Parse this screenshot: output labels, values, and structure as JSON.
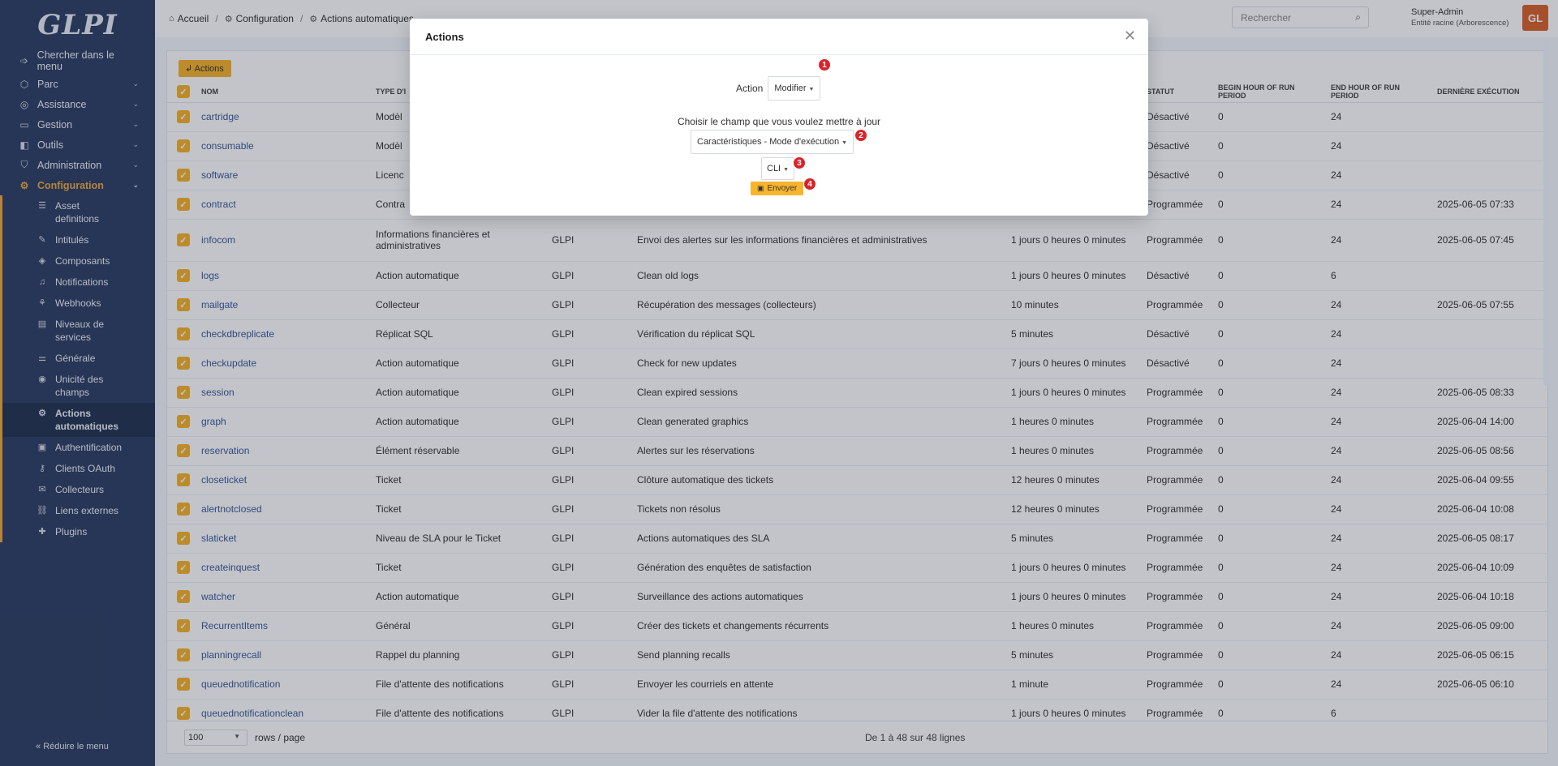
{
  "sidebar": {
    "logo": "GLPI",
    "menu": [
      {
        "label": "Chercher dans le menu",
        "icon": "arrow-right-icon",
        "has_chevron": false
      },
      {
        "label": "Parc",
        "icon": "box-icon",
        "has_chevron": true
      },
      {
        "label": "Assistance",
        "icon": "lifebuoy-icon",
        "has_chevron": true
      },
      {
        "label": "Gestion",
        "icon": "wallet-icon",
        "has_chevron": true
      },
      {
        "label": "Outils",
        "icon": "briefcase-icon",
        "has_chevron": true
      },
      {
        "label": "Administration",
        "icon": "shield-icon",
        "has_chevron": true
      },
      {
        "label": "Configuration",
        "icon": "gear-icon",
        "has_chevron": true
      }
    ],
    "submenu": [
      {
        "label": "Asset definitions",
        "icon": "database-icon"
      },
      {
        "label": "Intitulés",
        "icon": "edit-icon"
      },
      {
        "label": "Composants",
        "icon": "components-icon"
      },
      {
        "label": "Notifications",
        "icon": "bell-icon"
      },
      {
        "label": "Webhooks",
        "icon": "webhook-icon"
      },
      {
        "label": "Niveaux de services",
        "icon": "checklist-icon"
      },
      {
        "label": "Générale",
        "icon": "sliders-icon"
      },
      {
        "label": "Unicité des champs",
        "icon": "fingerprint-icon"
      },
      {
        "label": "Actions automatiques",
        "icon": "cog-icon"
      },
      {
        "label": "Authentification",
        "icon": "id-card-icon"
      },
      {
        "label": "Clients OAuth",
        "icon": "key-icon"
      },
      {
        "label": "Collecteurs",
        "icon": "mailbox-icon"
      },
      {
        "label": "Liens externes",
        "icon": "link-icon"
      },
      {
        "label": "Plugins",
        "icon": "puzzle-icon"
      }
    ],
    "collapse_label": "Réduire le menu"
  },
  "header": {
    "breadcrumb": [
      "Accueil",
      "Configuration",
      "Actions automatiques"
    ],
    "search_placeholder": "Rechercher",
    "user_name": "Super-Admin",
    "user_entity": "Entité racine (Arborescence)",
    "avatar_initials": "GL"
  },
  "toolbar": {
    "actions_label": "Actions"
  },
  "table": {
    "columns": [
      "Nom",
      "Type d'i",
      "",
      "",
      "",
      "Statut",
      "Begin hour of run period",
      "End hour of run period",
      "Dernière exécution"
    ],
    "rows": [
      [
        "cartridge",
        "Modèl",
        "",
        "",
        "",
        "Désactivé",
        "0",
        "24",
        ""
      ],
      [
        "consumable",
        "Modèl",
        "",
        "",
        "",
        "Désactivé",
        "0",
        "24",
        ""
      ],
      [
        "software",
        "Licenc",
        "",
        "",
        "",
        "Désactivé",
        "0",
        "24",
        ""
      ],
      [
        "contract",
        "Contra",
        "",
        "",
        "",
        "Programmée",
        "0",
        "24",
        "2025-06-05 07:33"
      ],
      [
        "infocom",
        "Informations financières et administratives",
        "GLPI",
        "Envoi des alertes sur les informations financières et administratives",
        "1 jours 0 heures 0 minutes",
        "Programmée",
        "0",
        "24",
        "2025-06-05 07:45"
      ],
      [
        "logs",
        "Action automatique",
        "GLPI",
        "Clean old logs",
        "1 jours 0 heures 0 minutes",
        "Désactivé",
        "0",
        "6",
        ""
      ],
      [
        "mailgate",
        "Collecteur",
        "GLPI",
        "Récupération des messages (collecteurs)",
        "10 minutes",
        "Programmée",
        "0",
        "24",
        "2025-06-05 07:55"
      ],
      [
        "checkdbreplicate",
        "Réplicat SQL",
        "GLPI",
        "Vérification du réplicat SQL",
        "5 minutes",
        "Désactivé",
        "0",
        "24",
        ""
      ],
      [
        "checkupdate",
        "Action automatique",
        "GLPI",
        "Check for new updates",
        "7 jours 0 heures 0 minutes",
        "Désactivé",
        "0",
        "24",
        ""
      ],
      [
        "session",
        "Action automatique",
        "GLPI",
        "Clean expired sessions",
        "1 jours 0 heures 0 minutes",
        "Programmée",
        "0",
        "24",
        "2025-06-05 08:33"
      ],
      [
        "graph",
        "Action automatique",
        "GLPI",
        "Clean generated graphics",
        "1 heures 0 minutes",
        "Programmée",
        "0",
        "24",
        "2025-06-04 14:00"
      ],
      [
        "reservation",
        "Élément réservable",
        "GLPI",
        "Alertes sur les réservations",
        "1 heures 0 minutes",
        "Programmée",
        "0",
        "24",
        "2025-06-05 08:56"
      ],
      [
        "closeticket",
        "Ticket",
        "GLPI",
        "Clôture automatique des tickets",
        "12 heures 0 minutes",
        "Programmée",
        "0",
        "24",
        "2025-06-04 09:55"
      ],
      [
        "alertnotclosed",
        "Ticket",
        "GLPI",
        "Tickets non résolus",
        "12 heures 0 minutes",
        "Programmée",
        "0",
        "24",
        "2025-06-04 10:08"
      ],
      [
        "slaticket",
        "Niveau de SLA pour le Ticket",
        "GLPI",
        "Actions automatiques des SLA",
        "5 minutes",
        "Programmée",
        "0",
        "24",
        "2025-06-05 08:17"
      ],
      [
        "createinquest",
        "Ticket",
        "GLPI",
        "Génération des enquêtes de satisfaction",
        "1 jours 0 heures 0 minutes",
        "Programmée",
        "0",
        "24",
        "2025-06-04 10:09"
      ],
      [
        "watcher",
        "Action automatique",
        "GLPI",
        "Surveillance des actions automatiques",
        "1 jours 0 heures 0 minutes",
        "Programmée",
        "0",
        "24",
        "2025-06-04 10:18"
      ],
      [
        "RecurrentItems",
        "Général",
        "GLPI",
        "Créer des tickets et changements récurrents",
        "1 heures 0 minutes",
        "Programmée",
        "0",
        "24",
        "2025-06-05 09:00"
      ],
      [
        "planningrecall",
        "Rappel du planning",
        "GLPI",
        "Send planning recalls",
        "5 minutes",
        "Programmée",
        "0",
        "24",
        "2025-06-05 06:15"
      ],
      [
        "queuednotification",
        "File d'attente des notifications",
        "GLPI",
        "Envoyer les courriels en attente",
        "1 minute",
        "Programmée",
        "0",
        "24",
        "2025-06-05 06:10"
      ],
      [
        "queuednotificationclean",
        "File d'attente des notifications",
        "GLPI",
        "Vider la file d'attente des notifications",
        "1 jours 0 heures 0 minutes",
        "Programmée",
        "0",
        "6",
        ""
      ]
    ]
  },
  "footer": {
    "page_size": "100",
    "rows_per_page": "rows / page",
    "pager_info": "De 1 à 48 sur 48 lignes"
  },
  "modal": {
    "title": "Actions",
    "action_label": "Action",
    "action_value": "Modifier",
    "choose_field_label": "Choisir le champ que vous voulez mettre à jour",
    "field_value": "Caractéristiques - Mode d'exécution",
    "mode_value": "CLI",
    "submit_label": "Envoyer",
    "badges": [
      "1",
      "2",
      "3",
      "4"
    ]
  },
  "colors": {
    "accent": "#f7b42c",
    "sidebar": "#2f3f64",
    "active_menu": "#f2a93b",
    "badge": "#d9242a"
  }
}
